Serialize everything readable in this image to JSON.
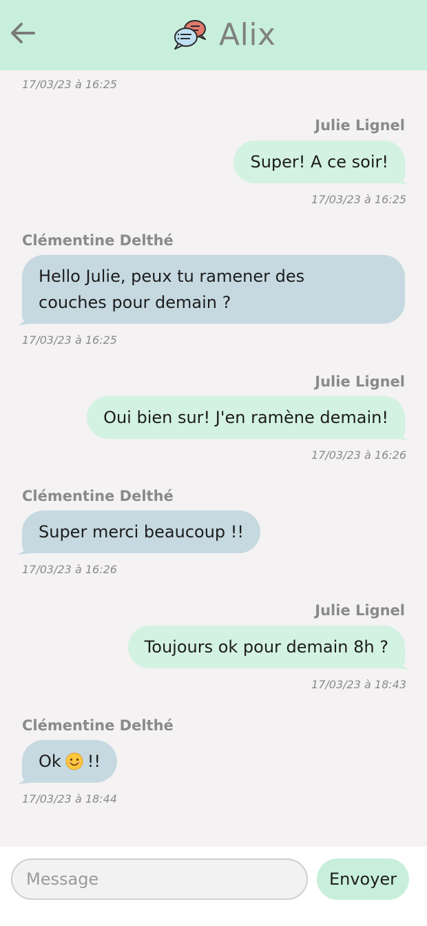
{
  "header": {
    "back_icon": "arrow-left-icon",
    "app_icon": "chat-bubbles-icon",
    "title": "Alix"
  },
  "colors": {
    "header_bg": "#c8efdb",
    "background": "#f4f2f3",
    "my_bubble": "#d3f2e2",
    "other_bubble": "#c6d9e1",
    "send_button": "#c8efdb"
  },
  "thread": {
    "top_timestamp": "17/03/23 à 16:25",
    "messages": [
      {
        "sender": "Julie Lignel",
        "text": "Super! A ce soir!",
        "time": "17/03/23 à 16:25",
        "side": "right"
      },
      {
        "sender": "Clémentine Delthé",
        "text_line1": "Hello Julie, peux tu ramener des",
        "text_line2": "couches pour demain ?",
        "time": "17/03/23 à 16:25",
        "side": "left"
      },
      {
        "sender": "Julie Lignel",
        "text": "Oui bien sur! J'en ramène demain!",
        "time": "17/03/23 à 16:26",
        "side": "right"
      },
      {
        "sender": "Clémentine Delthé",
        "text": "Super merci beaucoup !!",
        "time": "17/03/23 à 16:26",
        "side": "left"
      },
      {
        "sender": "Julie Lignel",
        "text": "Toujours ok pour demain 8h ?",
        "time": "17/03/23 à 18:43",
        "side": "right"
      },
      {
        "sender": "Clémentine Delthé",
        "text_before": "Ok",
        "emoji": "smiling-face-icon",
        "text_after": "!!",
        "time": "17/03/23 à 18:44",
        "side": "left"
      }
    ]
  },
  "composer": {
    "placeholder": "Message",
    "send_label": "Envoyer"
  }
}
